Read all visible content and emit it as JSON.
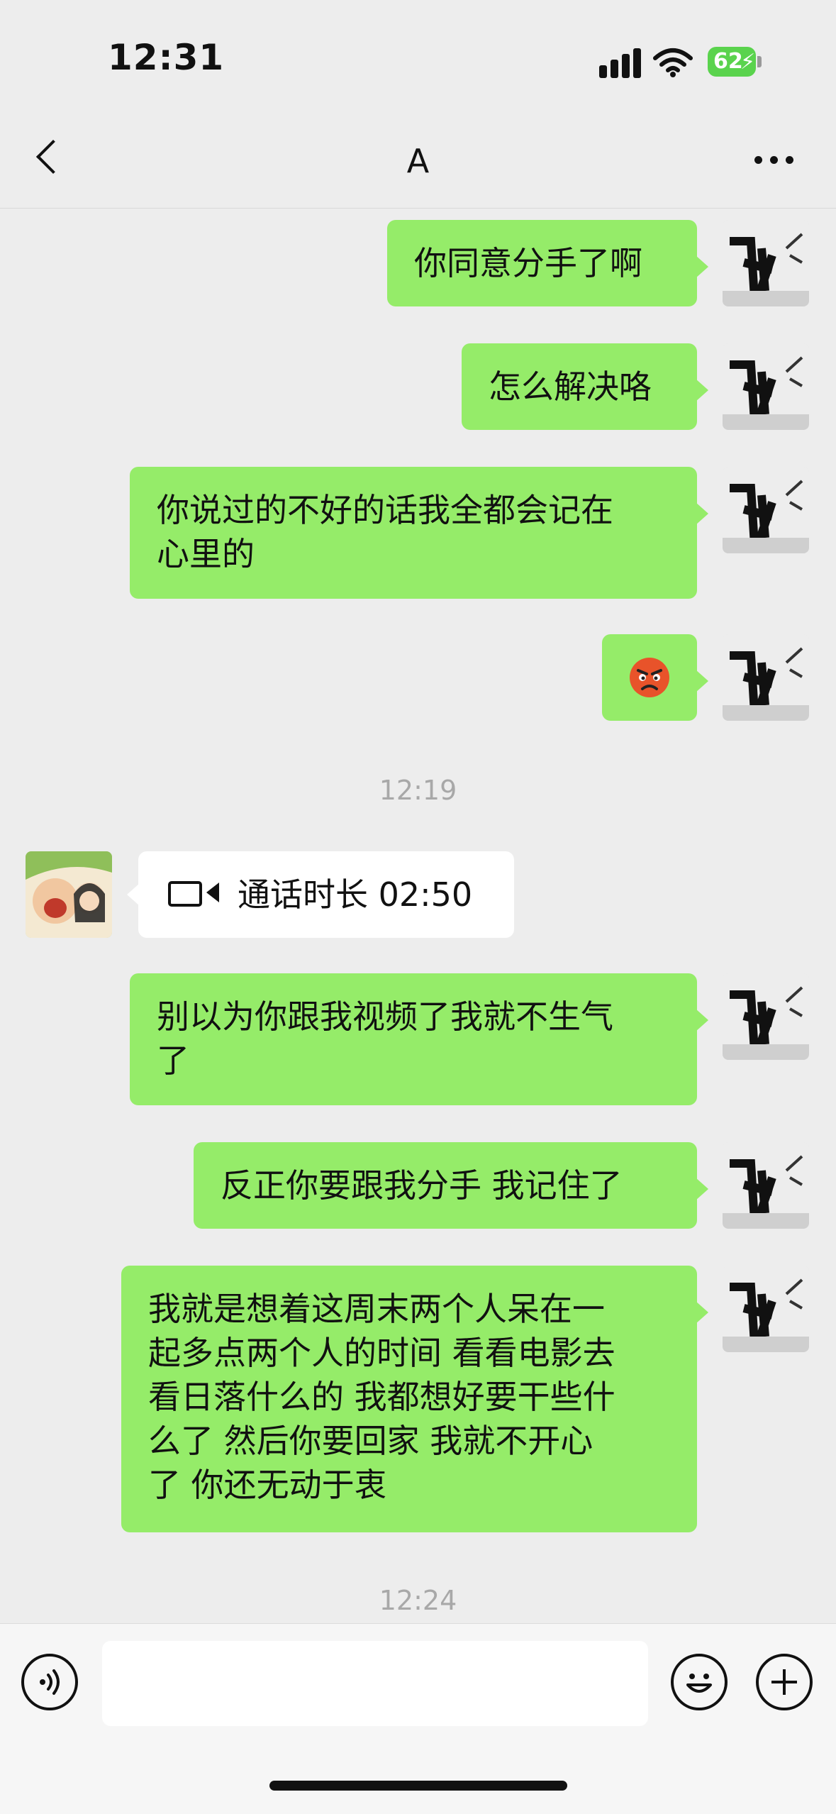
{
  "status_bar": {
    "time": "12:31",
    "battery": "62"
  },
  "header": {
    "title": "A"
  },
  "messages": [
    {
      "text": "你同意分手了啊"
    },
    {
      "text": "怎么解决咯"
    },
    {
      "text": "你说过的不好的话我全都会记在\n心里的"
    },
    {
      "text": "😡"
    },
    {
      "text": "别以为你跟我视频了我就不生气\n了"
    },
    {
      "text": "反正你要跟我分手 我记住了"
    },
    {
      "text": "我就是想着这周末两个人呆在一\n起多点两个人的时间 看看电影去\n看日落什么的 我都想好要干些什\n么了 然后你要回家 我就不开心\n了 你还无动于衷"
    }
  ],
  "timestamps": [
    "12:19",
    "12:24"
  ],
  "call_record": {
    "label": "通话时长 02:50"
  },
  "input": {
    "value": ""
  }
}
